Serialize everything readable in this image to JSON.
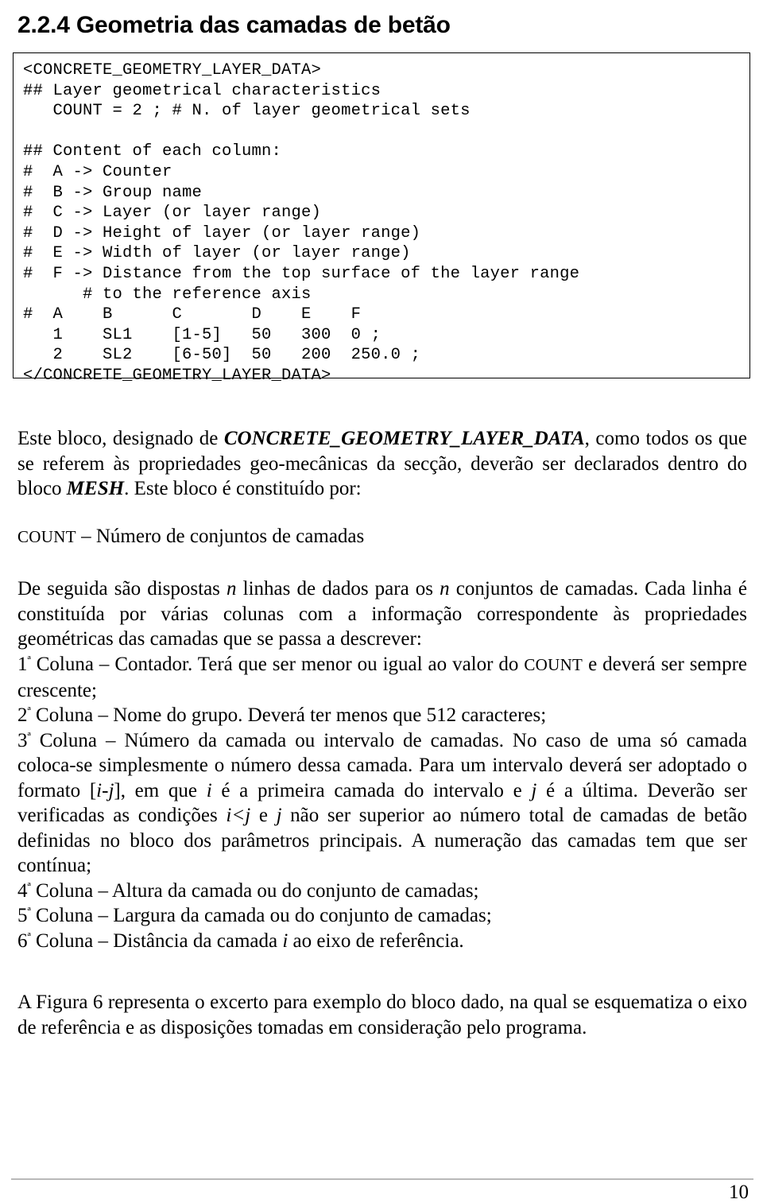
{
  "heading": {
    "text": "2.2.4 Geometria das camadas de betão"
  },
  "code_block": {
    "language": "plain-text",
    "content": "<CONCRETE_GEOMETRY_LAYER_DATA>\n## Layer geometrical characteristics\n   COUNT = 2 ; # N. of layer geometrical sets\n\n## Content of each column:\n#  A -> Counter\n#  B -> Group name\n#  C -> Layer (or layer range)\n#  D -> Height of layer (or layer range)\n#  E -> Width of layer (or layer range)\n#  F -> Distance from the top surface of the layer range\n      # to the reference axis\n#  A    B      C       D    E    F\n   1    SL1    [1-5]   50   300  0 ;\n   2    SL2    [6-50]  50   200  250.0 ;\n</CONCRETE_GEOMETRY_LAYER_DATA>",
    "lines": [
      "<CONCRETE_GEOMETRY_LAYER_DATA>",
      "## Layer geometrical characteristics",
      "   COUNT = 2 ; # N. of layer geometrical sets",
      "",
      "## Content of each column:",
      "#  A -> Counter",
      "#  B -> Group name",
      "#  C -> Layer (or layer range)",
      "#  D -> Height of layer (or layer range)",
      "#  E -> Width of layer (or layer range)",
      "#  F -> Distance from the top surface of the layer range",
      "      # to the reference axis",
      "#  A    B      C       D    E    F",
      "   1    SL1    [1-5]   50   300  0 ;",
      "   2    SL2    [6-50]  50   200  250.0 ;",
      "</CONCRETE_GEOMETRY_LAYER_DATA>"
    ],
    "block_name": "CONCRETE_GEOMETRY_LAYER_DATA",
    "count_value": "2",
    "table": {
      "headers": [
        "#",
        "A",
        "B",
        "C",
        "D",
        "E",
        "F"
      ],
      "rows": [
        [
          "",
          "1",
          "SL1",
          "[1-5]",
          "50",
          "300",
          "0 ;"
        ],
        [
          "",
          "2",
          "SL2",
          "[6-50]",
          "50",
          "200",
          "250.0 ;"
        ]
      ]
    }
  },
  "paragraphs": {
    "intro": {
      "part1": "Este bloco, designado de ",
      "emph1": "CONCRETE_GEOMETRY_LAYER_DATA",
      "part2": ", como todos os que se referem às propriedades geo-mecânicas da secção, deverão ser declarados dentro do bloco ",
      "emph2": "MESH",
      "part3": ". Este bloco é constituído por:"
    },
    "count_def": {
      "term": "COUNT",
      "text": " – Número de conjuntos de camadas"
    },
    "rows_desc": {
      "part1": "De seguida são dispostas ",
      "var1": "n",
      "part2": " linhas de dados para os ",
      "var2": "n",
      "part3": " conjuntos de camadas. Cada linha é constituída por várias colunas com a informação correspondente às propriedades geométricas das camadas que se passa a descrever:"
    },
    "columns": {
      "col1": {
        "ordinal": "1",
        "ordinal_suffix": "ª",
        "part1": " Coluna – Contador. Terá que ser menor ou igual ao valor do ",
        "term": "COUNT",
        "part2": " e deverá ser sempre crescente;"
      },
      "col2": {
        "ordinal": "2",
        "ordinal_suffix": "ª",
        "text": " Coluna – Nome do grupo. Deverá ter menos que 512 caracteres;"
      },
      "col3": {
        "ordinal": "3",
        "ordinal_suffix": "ª",
        "part1": " Coluna – Número da camada ou intervalo de camadas. No caso de uma só camada coloca-se simplesmente o número dessa camada. Para um intervalo deverá ser adoptado o formato [",
        "var_i1": "i-j",
        "part2": "], em que ",
        "var_i2": "i",
        "part3": " é a primeira camada do intervalo e ",
        "var_j1": "j",
        "part4": " é a última. Deverão ser verificadas as condições ",
        "var_cond": "i<j",
        "part5": " e ",
        "var_j2": "j",
        "part6": " não ser superior ao número total de camadas de betão definidas no bloco dos parâmetros principais. A numeração das camadas tem que ser contínua;"
      },
      "col4": {
        "ordinal": "4",
        "ordinal_suffix": "ª",
        "text": " Coluna – Altura da camada ou do conjunto de camadas;"
      },
      "col5": {
        "ordinal": "5",
        "ordinal_suffix": "ª",
        "text": " Coluna – Largura da camada ou do conjunto de camadas;"
      },
      "col6": {
        "ordinal": "6",
        "ordinal_suffix": "ª",
        "part1": " Coluna – Distância da camada ",
        "var_i": "i",
        "part2": " ao eixo de referência."
      }
    },
    "figura": {
      "text": "A Figura 6 representa o excerto para exemplo do bloco dado, na qual se esquematiza o eixo de referência e as disposições tomadas em consideração pelo programa."
    }
  },
  "footer": {
    "page_number": "10"
  }
}
